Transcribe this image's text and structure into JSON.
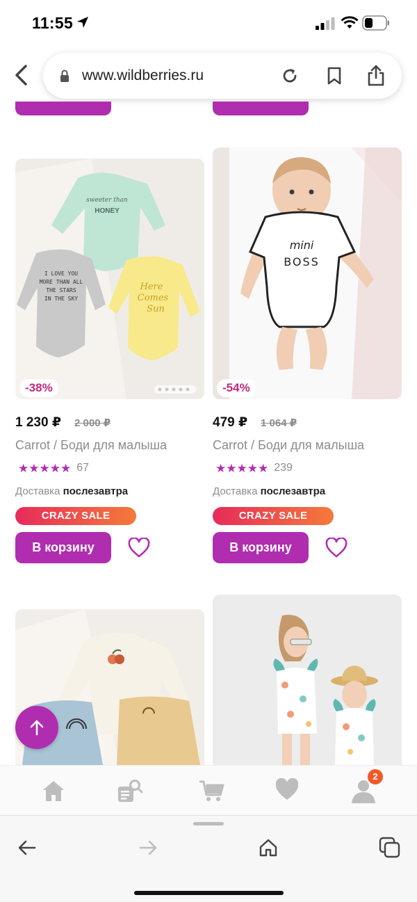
{
  "status_bar": {
    "time": "11:55"
  },
  "browser": {
    "url": "www.wildberries.ru"
  },
  "products": [
    {
      "discount": "-38%",
      "price": "1 230 ₽",
      "old_price": "2 000 ₽",
      "title": "Carrot / Боди для малыша",
      "stars": "★★★★★",
      "reviews": "67",
      "delivery_label": "Доставка",
      "delivery_value": "послезавтра",
      "sale_badge": "CRAZY SALE",
      "cart_button": "В корзину",
      "image_texts": [
        "sweeter than",
        "HONEY",
        "I LOVE YOU",
        "MORE THAN ALL",
        "THE STARS",
        "IN THE SKY",
        "Here",
        "Comes",
        "Sun"
      ]
    },
    {
      "discount": "-54%",
      "price": "479 ₽",
      "old_price": "1 064 ₽",
      "title": "Carrot / Боди для малыша",
      "stars": "★★★★★",
      "reviews": "239",
      "delivery_label": "Доставка",
      "delivery_value": "послезавтра",
      "sale_badge": "CRAZY SALE",
      "cart_button": "В корзину",
      "image_texts": [
        "mini",
        "BOSS"
      ]
    }
  ],
  "bottom_nav": {
    "items": [
      "home-icon",
      "catalog-search-icon",
      "cart-icon",
      "favorites-icon",
      "profile-icon"
    ],
    "profile_badge": "2"
  },
  "colors": {
    "accent": "#b02db0",
    "sale_start": "#e72b5a",
    "sale_end": "#f47a3b",
    "badge": "#f05a28"
  }
}
